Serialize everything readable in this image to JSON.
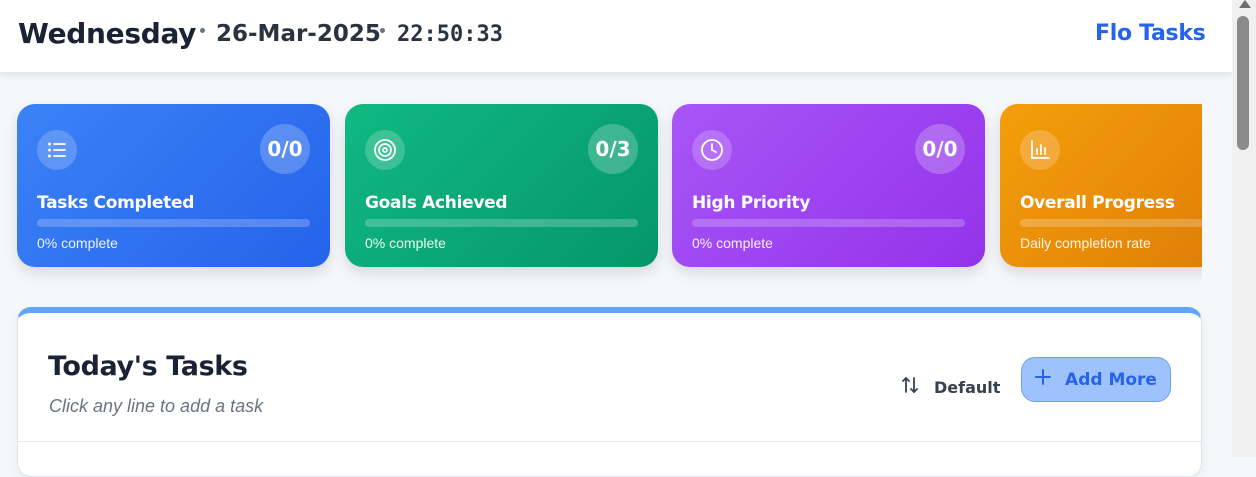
{
  "header": {
    "day": "Wednesday",
    "date": "26-Mar-2025",
    "time": "22:50:33",
    "brand": "Flo Tasks"
  },
  "cards": [
    {
      "icon": "list-icon",
      "count": "0/0",
      "label": "Tasks Completed",
      "subtitle": "0% complete",
      "progress": 0,
      "gradient_from": "#3b82f6",
      "gradient_to": "#2563eb"
    },
    {
      "icon": "target-icon",
      "count": "0/3",
      "label": "Goals Achieved",
      "subtitle": "0% complete",
      "progress": 0,
      "gradient_from": "#10b981",
      "gradient_to": "#059669"
    },
    {
      "icon": "clock-icon",
      "count": "0/0",
      "label": "High Priority",
      "subtitle": "0% complete",
      "progress": 0,
      "gradient_from": "#a855f7",
      "gradient_to": "#9333ea"
    },
    {
      "icon": "bar-chart-icon",
      "count": "",
      "label": "Overall Progress",
      "subtitle": "Daily completion rate",
      "progress": 0,
      "gradient_from": "#f59e0b",
      "gradient_to": "#d97706"
    }
  ],
  "tasks_panel": {
    "title": "Today's Tasks",
    "hint": "Click any line to add a task",
    "sort_label": "Default",
    "add_label": "Add More",
    "accent": "#60a5fa"
  }
}
